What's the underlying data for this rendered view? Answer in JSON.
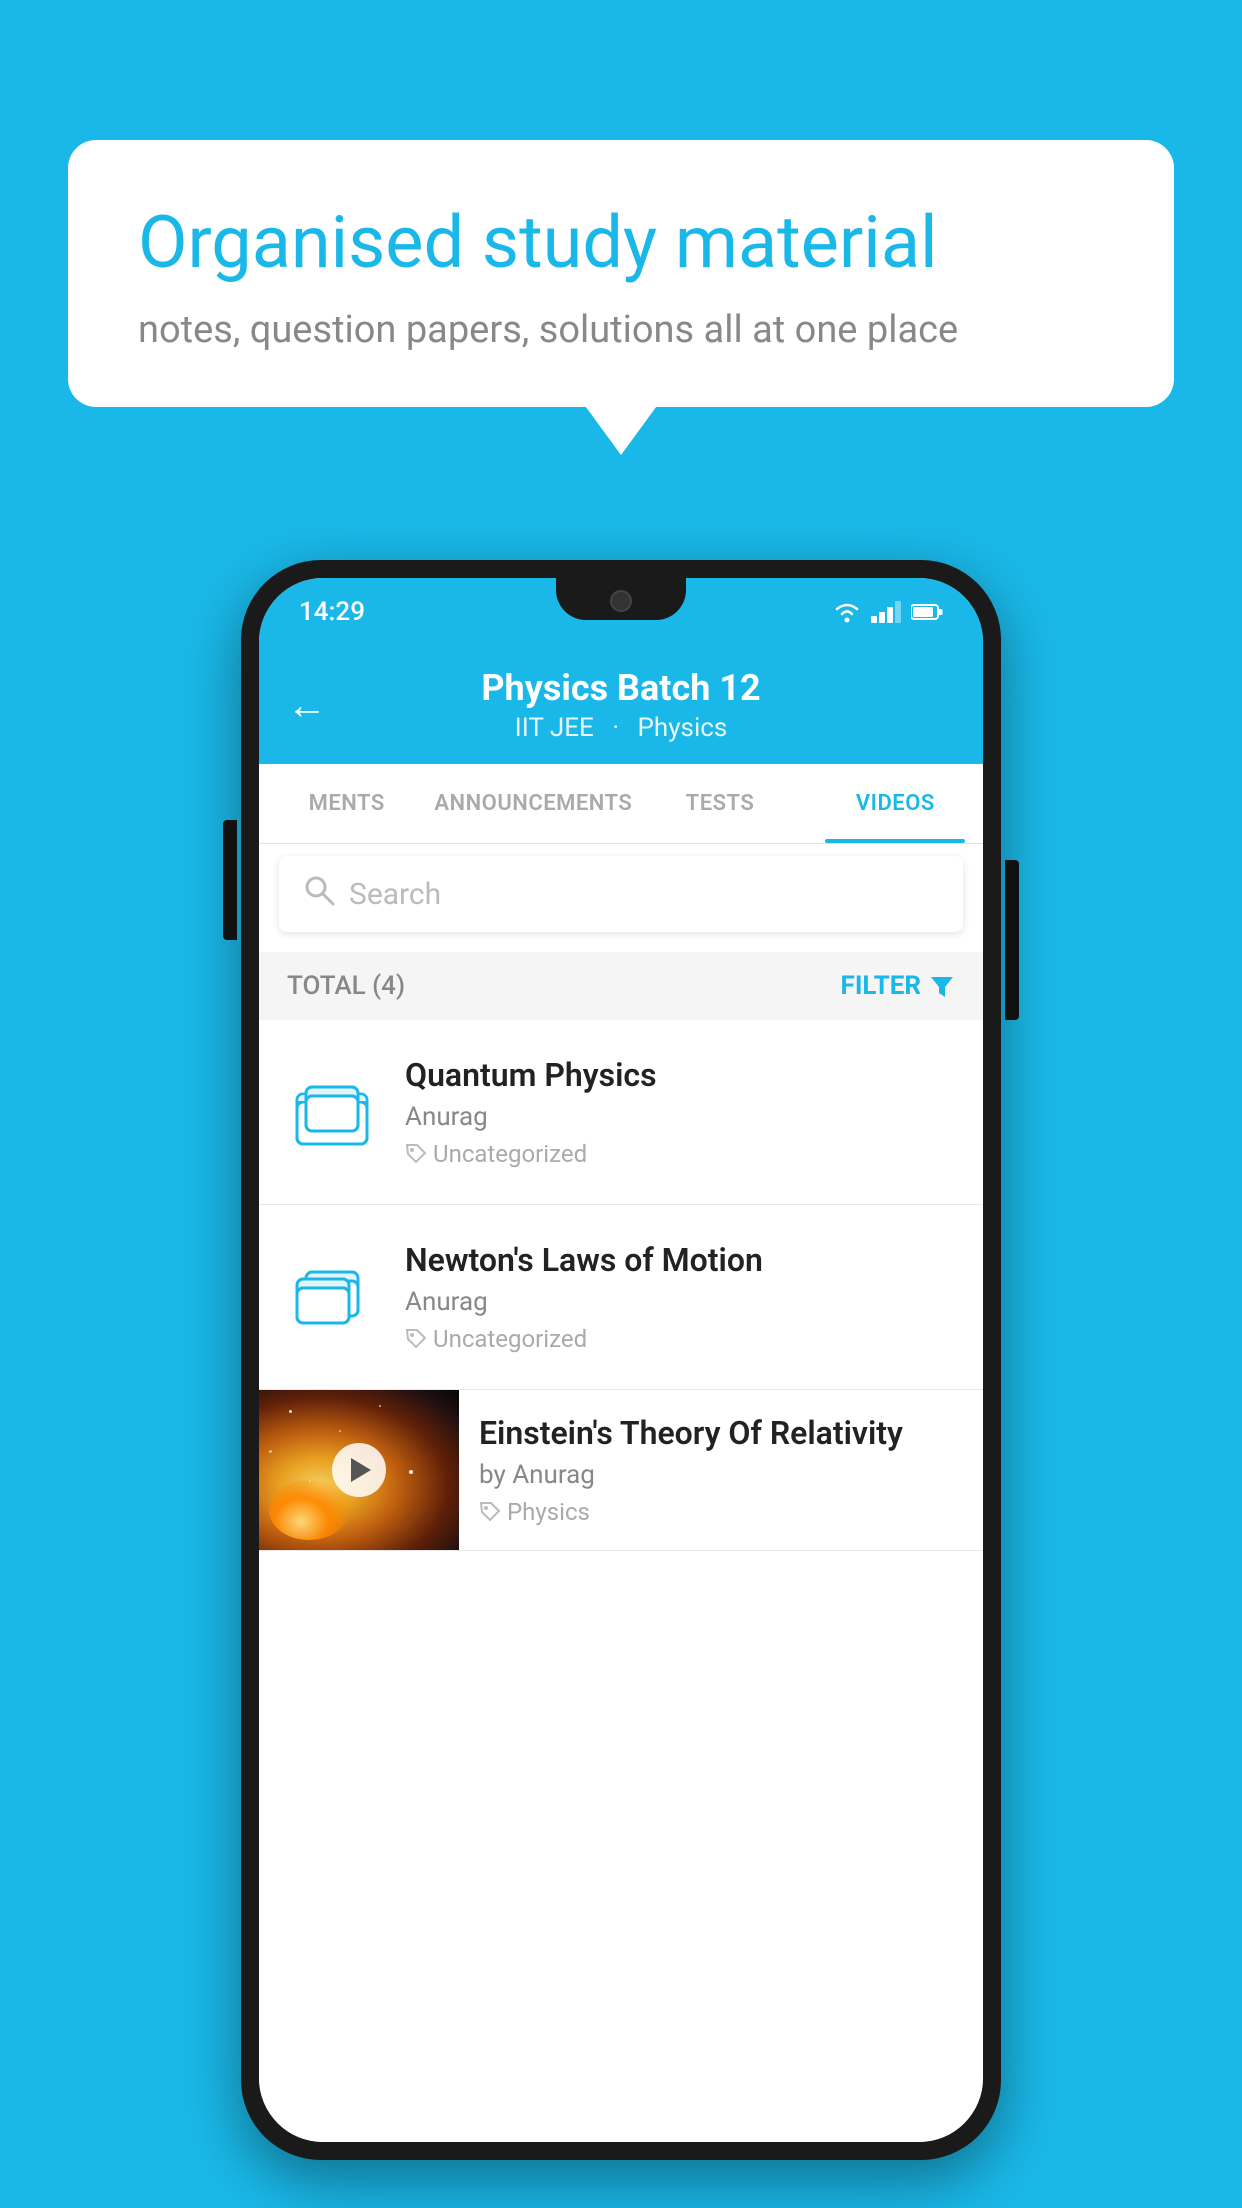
{
  "background": {
    "color": "#1ab8e8"
  },
  "speech_bubble": {
    "title": "Organised study material",
    "subtitle": "notes, question papers, solutions all at one place"
  },
  "status_bar": {
    "time": "14:29",
    "wifi": "▼",
    "battery": "🔋"
  },
  "app_header": {
    "back_label": "←",
    "title": "Physics Batch 12",
    "subtitle_part1": "IIT JEE",
    "subtitle_part2": "Physics"
  },
  "tabs": [
    {
      "label": "MENTS",
      "active": false
    },
    {
      "label": "ANNOUNCEMENTS",
      "active": false
    },
    {
      "label": "TESTS",
      "active": false
    },
    {
      "label": "VIDEOS",
      "active": true
    }
  ],
  "search": {
    "placeholder": "Search"
  },
  "filter_bar": {
    "total_label": "TOTAL (4)",
    "filter_label": "FILTER"
  },
  "list_items": [
    {
      "title": "Quantum Physics",
      "author": "Anurag",
      "tag": "Uncategorized",
      "has_thumb": false
    },
    {
      "title": "Newton's Laws of Motion",
      "author": "Anurag",
      "tag": "Uncategorized",
      "has_thumb": false
    },
    {
      "title": "Einstein's Theory Of Relativity",
      "author": "by Anurag",
      "tag": "Physics",
      "has_thumb": true
    }
  ]
}
